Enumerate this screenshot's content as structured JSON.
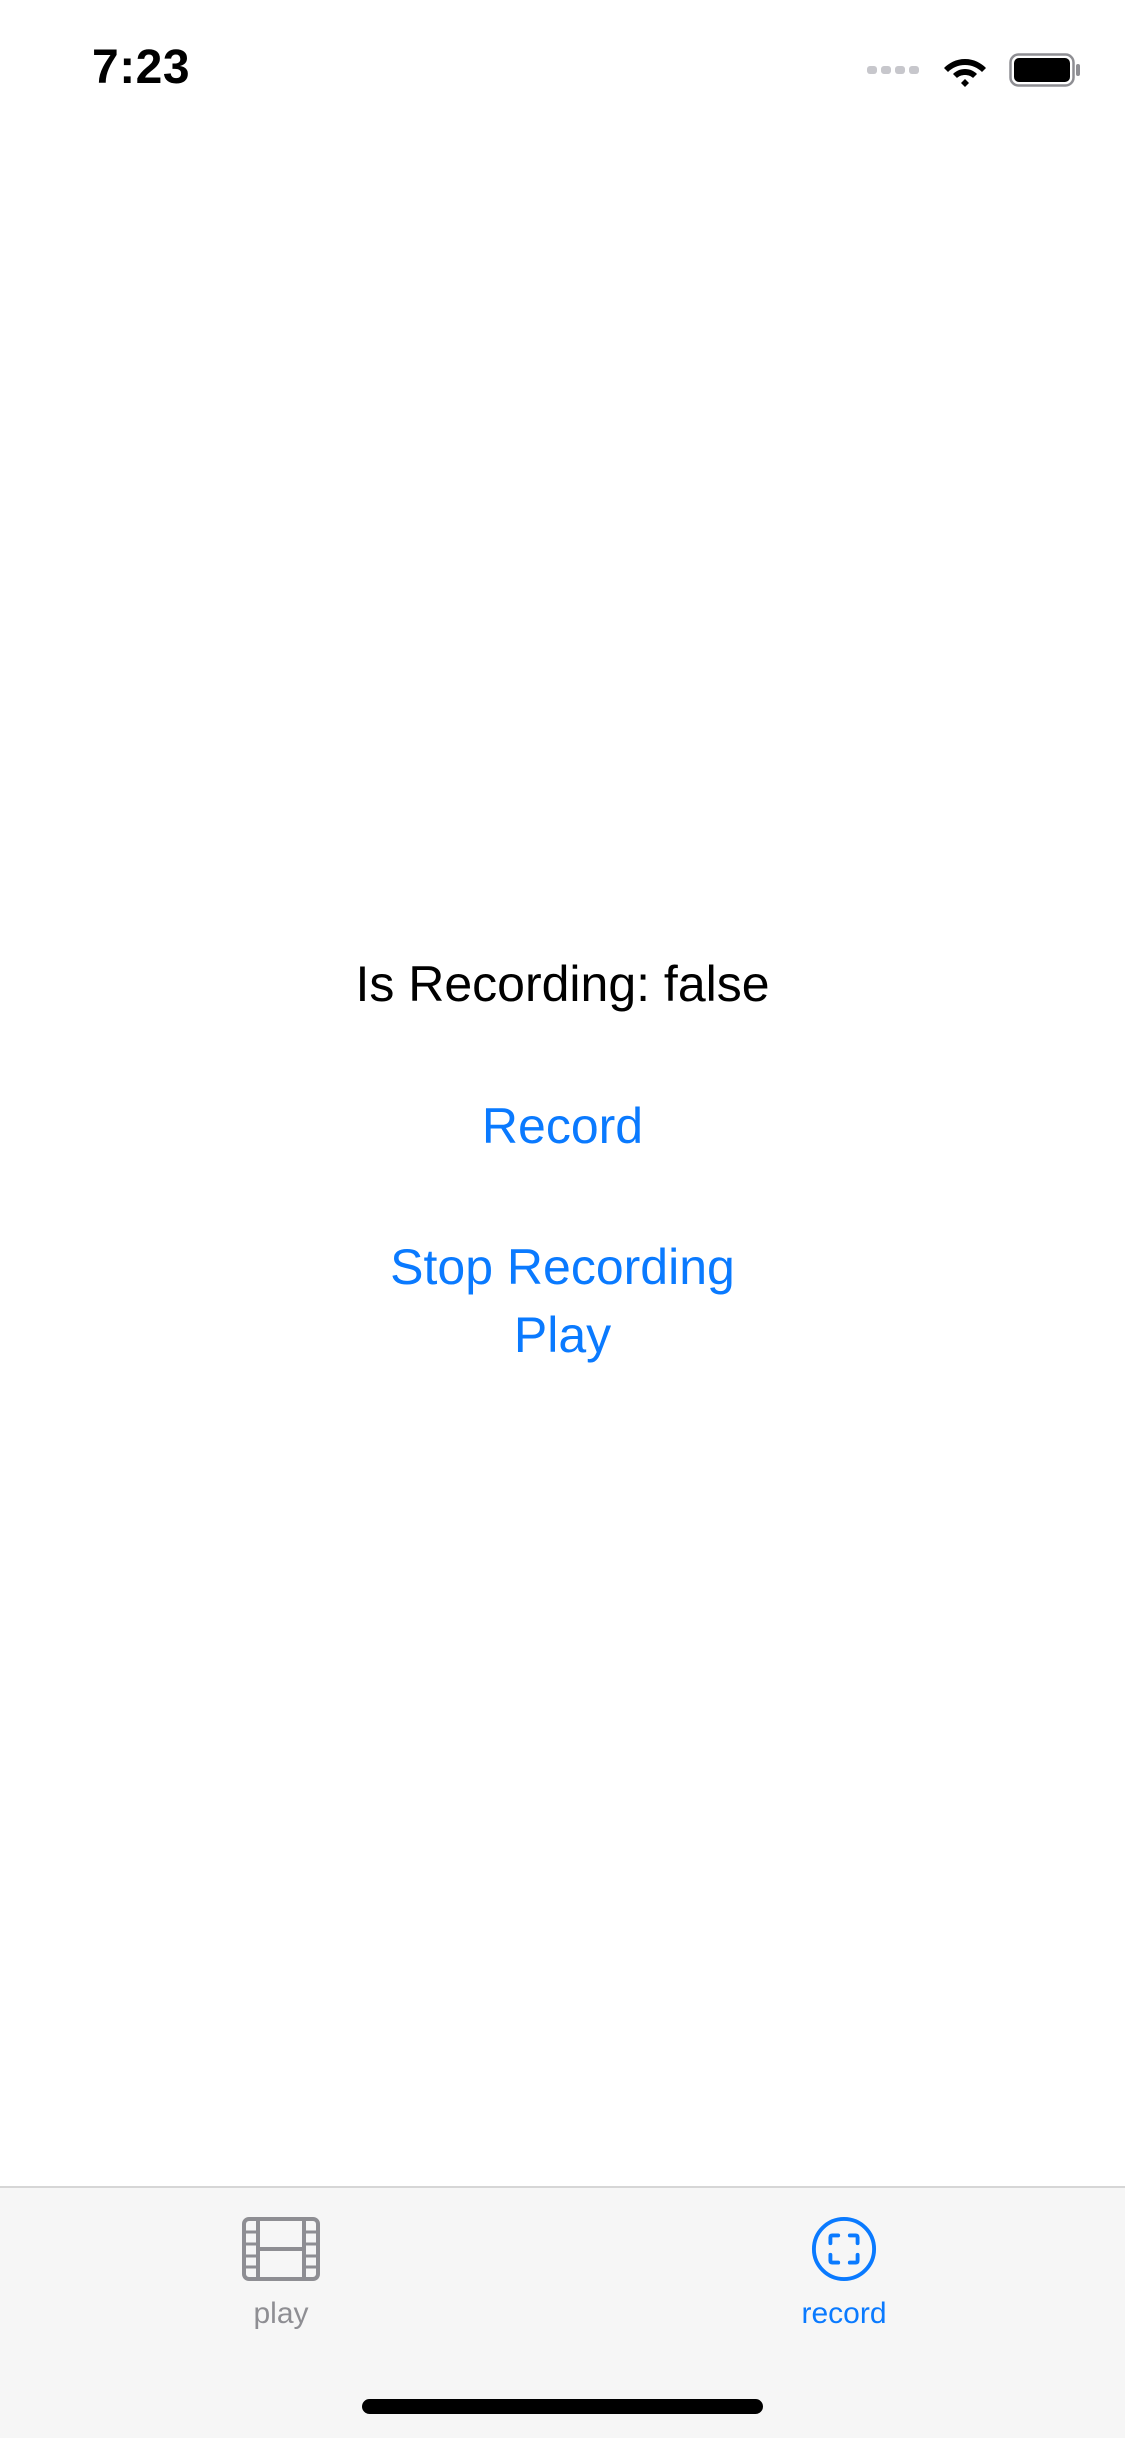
{
  "status_bar": {
    "time": "7:23",
    "icons": [
      "cellular-dots-icon",
      "wifi-icon",
      "battery-icon"
    ]
  },
  "main": {
    "recording_status": "Is Recording: false",
    "record_label": "Record",
    "stop_label": "Stop Recording",
    "play_label": "Play"
  },
  "tab_bar": {
    "tabs": [
      {
        "label": "play",
        "icon": "film-icon",
        "selected": false
      },
      {
        "label": "record",
        "icon": "record-screen-icon",
        "selected": true
      }
    ]
  },
  "colors": {
    "accent": "#0a7aff",
    "inactive": "#8e8e93",
    "tab_bar_bg": "#f6f6f6",
    "text": "#000000"
  }
}
